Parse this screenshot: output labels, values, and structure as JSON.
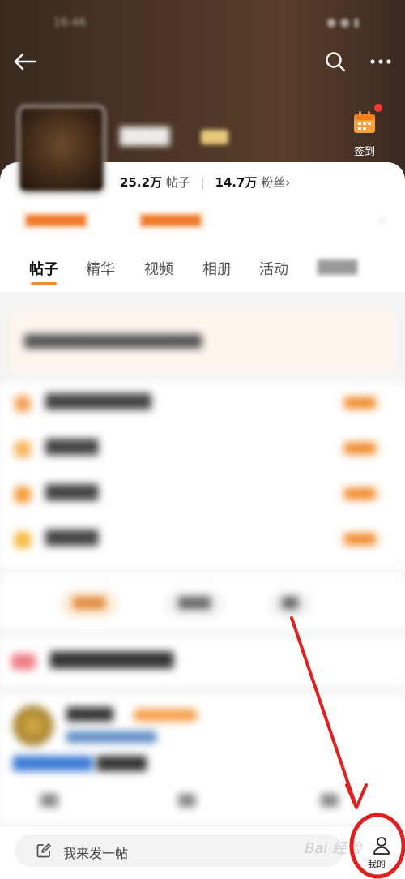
{
  "app": {
    "accent_color": "#f08a2a",
    "annotation_color": "#e02020"
  },
  "header": {
    "back_icon": "back-arrow-icon",
    "search_icon": "search-icon",
    "more_icon": "more-icon"
  },
  "forum": {
    "checkin_label": "签到",
    "posts_count": "25.2万",
    "posts_unit": "帖子",
    "fans_count": "14.7万",
    "fans_unit": "粉丝",
    "fans_chevron": "›"
  },
  "tabs": [
    {
      "label": "帖子",
      "active": true
    },
    {
      "label": "精华",
      "active": false
    },
    {
      "label": "视频",
      "active": false
    },
    {
      "label": "相册",
      "active": false
    },
    {
      "label": "活动",
      "active": false
    }
  ],
  "bottom_bar": {
    "compose_placeholder": "我来发一帖",
    "mine_label": "我的"
  },
  "watermark": "Bai 经验"
}
